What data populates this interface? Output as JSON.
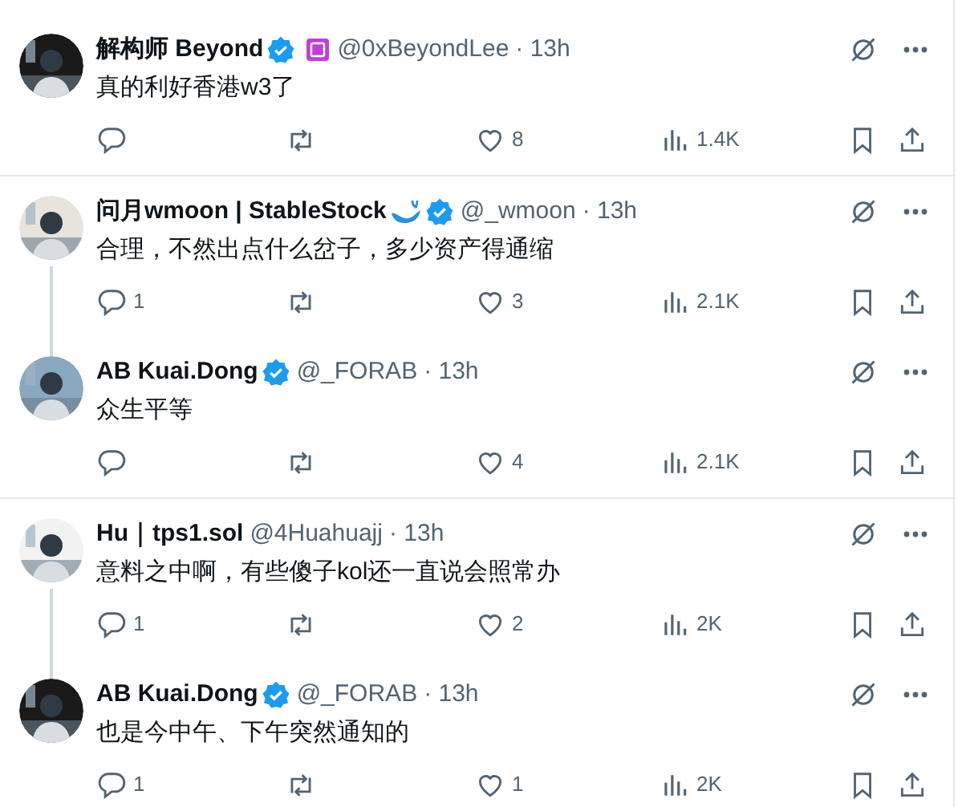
{
  "threads": [
    {
      "tweets": [
        {
          "name": "解构师 Beyond",
          "verified": true,
          "affiliate_badge": true,
          "whale": false,
          "handle": "@0xBeyondLee",
          "time": "· 13h",
          "text": "真的利好香港w3了",
          "likes": "8",
          "views": "1.4K"
        }
      ]
    },
    {
      "tweets": [
        {
          "name": "问月wmoon | StableStock",
          "verified": true,
          "affiliate_badge": false,
          "whale": true,
          "handle": "@_wmoon",
          "time": "· 13h",
          "text": "合理，不然出点什么岔子，多少资产得通缩",
          "replies": "1",
          "likes": "3",
          "views": "2.1K"
        },
        {
          "name": "AB Kuai.Dong",
          "verified": true,
          "affiliate_badge": false,
          "whale": false,
          "handle": "@_FORAB",
          "time": "· 13h",
          "text": "众生平等",
          "likes": "4",
          "views": "2.1K"
        }
      ]
    },
    {
      "tweets": [
        {
          "name": "Hu｜tps1.sol",
          "verified": false,
          "affiliate_badge": false,
          "whale": false,
          "handle": "@4Huahuajj",
          "time": "· 13h",
          "text": "意料之中啊，有些傻子kol还一直说会照常办",
          "replies": "1",
          "likes": "2",
          "views": "2K"
        },
        {
          "name": "AB Kuai.Dong",
          "verified": true,
          "affiliate_badge": false,
          "whale": false,
          "handle": "@_FORAB",
          "time": "· 13h",
          "text": "也是今中午、下午突然通知的",
          "replies": "1",
          "likes": "1",
          "views": "2K"
        }
      ]
    }
  ]
}
